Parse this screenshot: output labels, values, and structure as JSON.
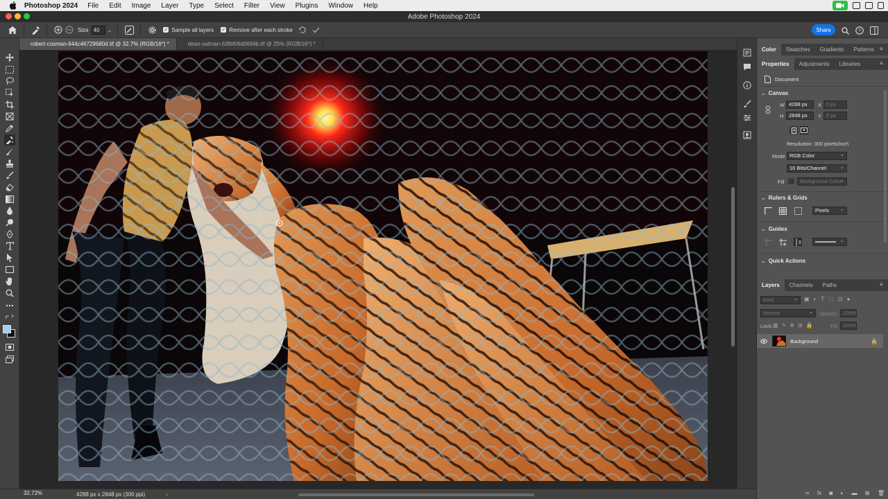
{
  "menubar": {
    "app_name": "Photoshop 2024",
    "items": [
      "File",
      "Edit",
      "Image",
      "Layer",
      "Type",
      "Select",
      "Filter",
      "View",
      "Plugins",
      "Window",
      "Help"
    ]
  },
  "window": {
    "title": "Adobe Photoshop 2024"
  },
  "options_bar": {
    "size_label": "Size",
    "size_value": "40",
    "sample_all_layers": "Sample all layers",
    "remove_after_each_stroke": "Remove after each stroke",
    "share_label": "Share"
  },
  "tabs": [
    {
      "label": "robert-cosman-644c46729680d.tif @ 32.7% (RGB/16*) *",
      "active": true
    },
    {
      "label": "dean-salman-63fbf06d0694b.tif @ 25% (RGB/16*) *",
      "active": false
    }
  ],
  "status": {
    "zoom": "32.72%",
    "info": "4288 px x 2848 px (300 ppi)"
  },
  "panels": {
    "top_tabs": [
      "Color",
      "Swatches",
      "Gradients",
      "Patterns"
    ],
    "props_tabs": [
      "Properties",
      "Adjustments",
      "Libraries"
    ],
    "document_label": "Document",
    "canvas": {
      "title": "Canvas",
      "w_label": "W",
      "w_value": "4288 px",
      "h_label": "H",
      "h_value": "2848 px",
      "x_label": "X",
      "x_value": "0 px",
      "y_label": "Y",
      "y_value": "0 px",
      "resolution": "Resolution: 300 pixels/inch",
      "mode_label": "Mode",
      "mode_value": "RGB Color",
      "bits_value": "16 Bits/Channel",
      "fill_label": "Fill",
      "fill_value": "Background Color"
    },
    "rulers": {
      "title": "Rulers & Grids",
      "units": "Pixels"
    },
    "guides": {
      "title": "Guides"
    },
    "quick_actions": {
      "title": "Quick Actions"
    },
    "layers_tabs": [
      "Layers",
      "Channels",
      "Paths"
    ],
    "layers": {
      "kind_placeholder": "Kind",
      "blend_mode": "Normal",
      "opacity_label": "Opacity:",
      "opacity_value": "100%",
      "lock_label": "Lock:",
      "fill_label": "Fill:",
      "fill_value": "100%",
      "layer_name": "Background"
    }
  },
  "colors": {
    "accent": "#1473e6",
    "facetime": "#2fbf4a",
    "foreground_swatch": "#9fd0ee",
    "background_swatch": "#111111"
  }
}
